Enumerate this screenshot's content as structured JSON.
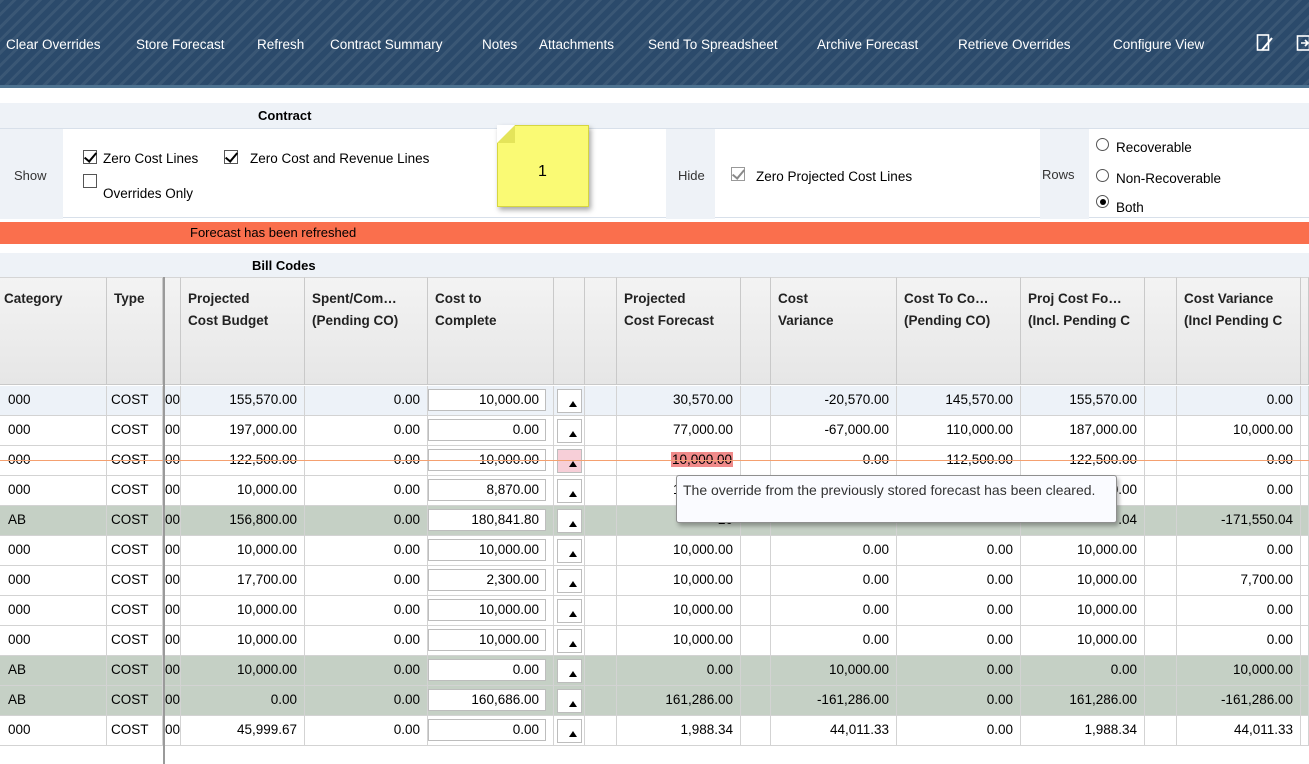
{
  "toolbar": {
    "items": [
      "Clear Overrides",
      "Store Forecast",
      "Refresh",
      "Contract Summary",
      "Notes",
      "Attachments",
      "Send To Spreadsheet",
      "Archive Forecast",
      "Retrieve Overrides",
      "Configure View"
    ],
    "icons": [
      "edit-icon",
      "export-icon"
    ]
  },
  "contract": {
    "title": "Contract",
    "show_label": "Show",
    "zero_cost_lines": {
      "label": "Zero Cost Lines",
      "checked": true
    },
    "zero_cost_revenue_lines": {
      "label": "Zero Cost and Revenue Lines",
      "checked": true
    },
    "overrides_only": {
      "label": "Overrides Only",
      "checked": false
    },
    "sticky_note": "1",
    "hide_label": "Hide",
    "zero_projected_cost_lines": {
      "label": "Zero Projected Cost Lines",
      "checked": true,
      "disabled": true
    },
    "rows_label": "Rows",
    "rows_options": [
      {
        "label": "Recoverable",
        "selected": false
      },
      {
        "label": "Non-Recoverable",
        "selected": false
      },
      {
        "label": "Both",
        "selected": true
      }
    ]
  },
  "status": {
    "message": "Forecast has been refreshed",
    "color": "#fa6f4d"
  },
  "bill_codes": {
    "title": "Bill Codes",
    "columns": {
      "category": "Category",
      "type": "Type",
      "projected_cost_budget": [
        "Projected",
        "Cost Budget"
      ],
      "spent_committed": [
        "Spent/Com…",
        "(Pending CO)"
      ],
      "cost_to_complete": [
        "Cost to",
        "Complete"
      ],
      "projected_cost_forecast": [
        "Projected",
        "Cost Forecast"
      ],
      "cost_variance": [
        "Cost",
        "Variance"
      ],
      "cost_to_complete_pending": [
        "Cost To Co…",
        "(Pending CO)"
      ],
      "proj_cost_forecast_pending": [
        "Proj Cost Fo…",
        "(Incl. Pending C"
      ],
      "cost_variance_pending": [
        "Cost Variance",
        "(Incl Pending C"
      ]
    },
    "rows": [
      {
        "category": "000",
        "type": "COST",
        "clip": "00",
        "budget": "155,570.00",
        "spent": "0.00",
        "ctc": "10,000.00",
        "forecast": "30,570.00",
        "variance": "-20,570.00",
        "ctc_pending": "145,570.00",
        "forecast_pending": "155,570.00",
        "variance_pending": "0.00",
        "style": "selected"
      },
      {
        "category": "000",
        "type": "COST",
        "clip": "00",
        "budget": "197,000.00",
        "spent": "0.00",
        "ctc": "0.00",
        "forecast": "77,000.00",
        "variance": "-67,000.00",
        "ctc_pending": "110,000.00",
        "forecast_pending": "187,000.00",
        "variance_pending": "10,000.00",
        "style": "plain"
      },
      {
        "category": "000",
        "type": "COST",
        "clip": "00",
        "budget": "122,500.00",
        "spent": "0.00",
        "ctc": "10,000.00",
        "forecast": "10,000.00",
        "variance": "0.00",
        "ctc_pending": "112,500.00",
        "forecast_pending": "122,500.00",
        "variance_pending": "0.00",
        "style": "plain",
        "override": true
      },
      {
        "category": "000",
        "type": "COST",
        "clip": "00",
        "budget": "10,000.00",
        "spent": "0.00",
        "ctc": "8,870.00",
        "forecast": "10,000.00",
        "variance": "0.00",
        "ctc_pending": "0.00",
        "forecast_pending": "10,000.00",
        "variance_pending": "0.00",
        "style": "plain"
      },
      {
        "category": "AB",
        "type": "COST",
        "clip": "00",
        "budget": "156,800.00",
        "spent": "0.00",
        "ctc": "180,841.80",
        "forecast": "20",
        "variance": "",
        "ctc_pending": "",
        "forecast_pending": ".04",
        "variance_pending": "-171,550.04",
        "style": "green"
      },
      {
        "category": "000",
        "type": "COST",
        "clip": "00",
        "budget": "10,000.00",
        "spent": "0.00",
        "ctc": "10,000.00",
        "forecast": "10,000.00",
        "variance": "0.00",
        "ctc_pending": "0.00",
        "forecast_pending": "10,000.00",
        "variance_pending": "0.00",
        "style": "plain"
      },
      {
        "category": "000",
        "type": "COST",
        "clip": "00",
        "budget": "17,700.00",
        "spent": "0.00",
        "ctc": "2,300.00",
        "forecast": "10,000.00",
        "variance": "0.00",
        "ctc_pending": "0.00",
        "forecast_pending": "10,000.00",
        "variance_pending": "7,700.00",
        "style": "plain"
      },
      {
        "category": "000",
        "type": "COST",
        "clip": "00",
        "budget": "10,000.00",
        "spent": "0.00",
        "ctc": "10,000.00",
        "forecast": "10,000.00",
        "variance": "0.00",
        "ctc_pending": "0.00",
        "forecast_pending": "10,000.00",
        "variance_pending": "0.00",
        "style": "plain"
      },
      {
        "category": "000",
        "type": "COST",
        "clip": "00",
        "budget": "10,000.00",
        "spent": "0.00",
        "ctc": "10,000.00",
        "forecast": "10,000.00",
        "variance": "0.00",
        "ctc_pending": "0.00",
        "forecast_pending": "10,000.00",
        "variance_pending": "0.00",
        "style": "plain"
      },
      {
        "category": "AB",
        "type": "COST",
        "clip": "00",
        "budget": "10,000.00",
        "spent": "0.00",
        "ctc": "0.00",
        "forecast": "0.00",
        "variance": "10,000.00",
        "ctc_pending": "0.00",
        "forecast_pending": "0.00",
        "variance_pending": "10,000.00",
        "style": "green"
      },
      {
        "category": "AB",
        "type": "COST",
        "clip": "00",
        "budget": "0.00",
        "spent": "0.00",
        "ctc": "160,686.00",
        "forecast": "161,286.00",
        "variance": "-161,286.00",
        "ctc_pending": "0.00",
        "forecast_pending": "161,286.00",
        "variance_pending": "-161,286.00",
        "style": "green"
      },
      {
        "category": "000",
        "type": "COST",
        "clip": "00",
        "budget": "45,999.67",
        "spent": "0.00",
        "ctc": "0.00",
        "forecast": "1,988.34",
        "variance": "44,011.33",
        "ctc_pending": "0.00",
        "forecast_pending": "1,988.34",
        "variance_pending": "44,011.33",
        "style": "plain"
      }
    ]
  },
  "tooltip": "The override from the previously stored forecast has been cleared.",
  "colors": {
    "toolbar": "#2b4a6b",
    "status_bar": "#fa6f4d",
    "override_cell": "#f08a8a",
    "sticky_note": "#fafa74",
    "summary_row": "#c5d0c5"
  }
}
